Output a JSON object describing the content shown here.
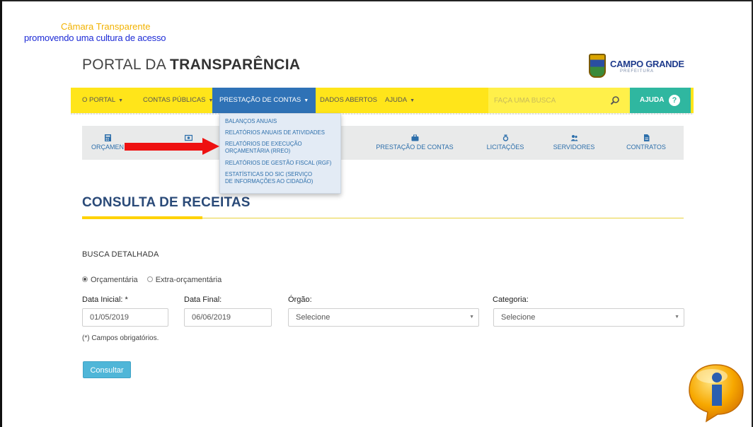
{
  "slide": {
    "title_line1": "Câmara Transparente",
    "title_line2": "promovendo uma cultura de acesso"
  },
  "header": {
    "brand_light": "PORTAL DA ",
    "brand_bold": "TRANSPARÊNCIA",
    "logo_text": "CAMPO GRANDE",
    "logo_sub": "PREFEITURA"
  },
  "navbar": {
    "items": [
      {
        "label": "O PORTAL"
      },
      {
        "label": "CONTAS PÚBLICAS"
      },
      {
        "label": "PRESTAÇÃO DE CONTAS"
      },
      {
        "label": "DADOS ABERTOS"
      },
      {
        "label": "AJUDA"
      }
    ],
    "search_placeholder": "FAÇA UMA BUSCA",
    "help_label": "AJUDA",
    "help_symbol": "?"
  },
  "dropdown": {
    "items": [
      {
        "label": "BALANÇOS ANUAIS"
      },
      {
        "label": "RELATÓRIOS ANUAIS DE ATIVIDADES"
      },
      {
        "label": "RELATÓRIOS DE EXECUÇÃO ORÇAMENTÁRIA (RREO)"
      },
      {
        "label": "RELATÓRIOS DE GESTÃO FISCAL (RGF)"
      },
      {
        "label": "ESTATÍSTICAS DO SIC (SERVIÇO DE INFORMAÇÕES AO CIDADÃO)"
      }
    ]
  },
  "subnav": {
    "items": [
      {
        "label": "ORÇAMEN",
        "icon": "calculator-icon"
      },
      {
        "label": "",
        "icon": "money-icon"
      },
      {
        "label": "PRESTAÇÃO DE CONTAS",
        "icon": "briefcase-icon"
      },
      {
        "label": "LICITAÇÕES",
        "icon": "gavel-icon"
      },
      {
        "label": "SERVIDORES",
        "icon": "users-icon"
      },
      {
        "label": "CONTRATOS",
        "icon": "document-icon"
      }
    ]
  },
  "main": {
    "section_title": "CONSULTA DE RECEITAS",
    "busca_label": "BUSCA DETALHADA",
    "radio_options": [
      {
        "label": "Orçamentária",
        "selected": true
      },
      {
        "label": "Extra-orçamentária",
        "selected": false
      }
    ],
    "fields": {
      "data_inicial_label": "Data Inicial: *",
      "data_inicial_value": "01/05/2019",
      "data_final_label": "Data Final:",
      "data_final_value": "06/06/2019",
      "orgao_label": "Órgão:",
      "orgao_value": "Selecione",
      "categoria_label": "Categoria:",
      "categoria_value": "Selecione"
    },
    "required_note": "(*) Campos obrigatórios.",
    "consult_button": "Consultar"
  },
  "colors": {
    "navbar": "#ffe51a",
    "active_nav": "#2f72b6",
    "help_button": "#2fb7a0",
    "title": "#2a4a78",
    "accent_rule": "#ffd200",
    "arrow": "#ee1111",
    "consult_button": "#4fb6d8"
  }
}
